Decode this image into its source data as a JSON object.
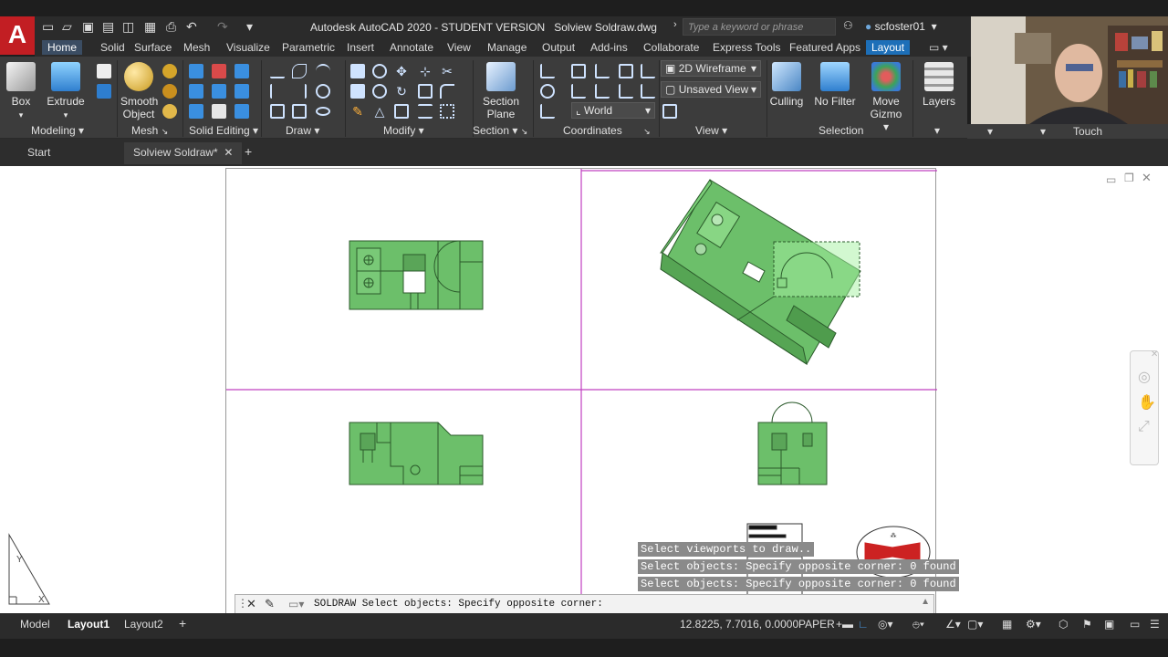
{
  "window": {
    "title": "Autodesk AutoCAD 2020 - STUDENT VERSION",
    "file": "Solview Soldraw.dwg",
    "search_placeholder": "Type a keyword or phrase",
    "user": "scfoster01"
  },
  "ribbon_tabs": [
    "Home",
    "Solid",
    "Surface",
    "Mesh",
    "Visualize",
    "Parametric",
    "Insert",
    "Annotate",
    "View",
    "Manage",
    "Output",
    "Add-ins",
    "Collaborate",
    "Express Tools",
    "Featured Apps",
    "Layout"
  ],
  "panels": {
    "modeling": "Modeling",
    "mesh": "Mesh",
    "solid_editing": "Solid Editing",
    "draw": "Draw",
    "modify": "Modify",
    "section": "Section",
    "coordinates": "Coordinates",
    "view": "View",
    "selection": "Selection",
    "touch": "Touch"
  },
  "buttons": {
    "box": "Box",
    "extrude": "Extrude",
    "smooth_object_1": "Smooth",
    "smooth_object_2": "Object",
    "section_plane_1": "Section",
    "section_plane_2": "Plane",
    "culling": "Culling",
    "no_filter": "No Filter",
    "move_gizmo_1": "Move",
    "move_gizmo_2": "Gizmo",
    "layers": "Layers"
  },
  "dropdowns": {
    "visual_style": "2D Wireframe",
    "view": "Unsaved View",
    "ucs": "World"
  },
  "doc_tabs": {
    "start": "Start",
    "active": "Solview Soldraw*"
  },
  "command": {
    "history": [
      "Select viewports to draw..",
      "Select objects: Specify opposite corner: 0 found",
      "Select objects: Specify opposite corner: 0 found"
    ],
    "prompt": "SOLDRAW Select objects: Specify opposite corner:"
  },
  "status": {
    "model": "Model",
    "layout1": "Layout1",
    "layout2": "Layout2",
    "coords": "12.8225, 7.7016, 0.0000",
    "space": "PAPER"
  },
  "colors": {
    "accent": "#1d6fb8",
    "logo": "#c21e23",
    "part_fill": "#6cbf6a",
    "part_stroke": "#2b5a2b",
    "viewport_border": "#c040c0"
  }
}
